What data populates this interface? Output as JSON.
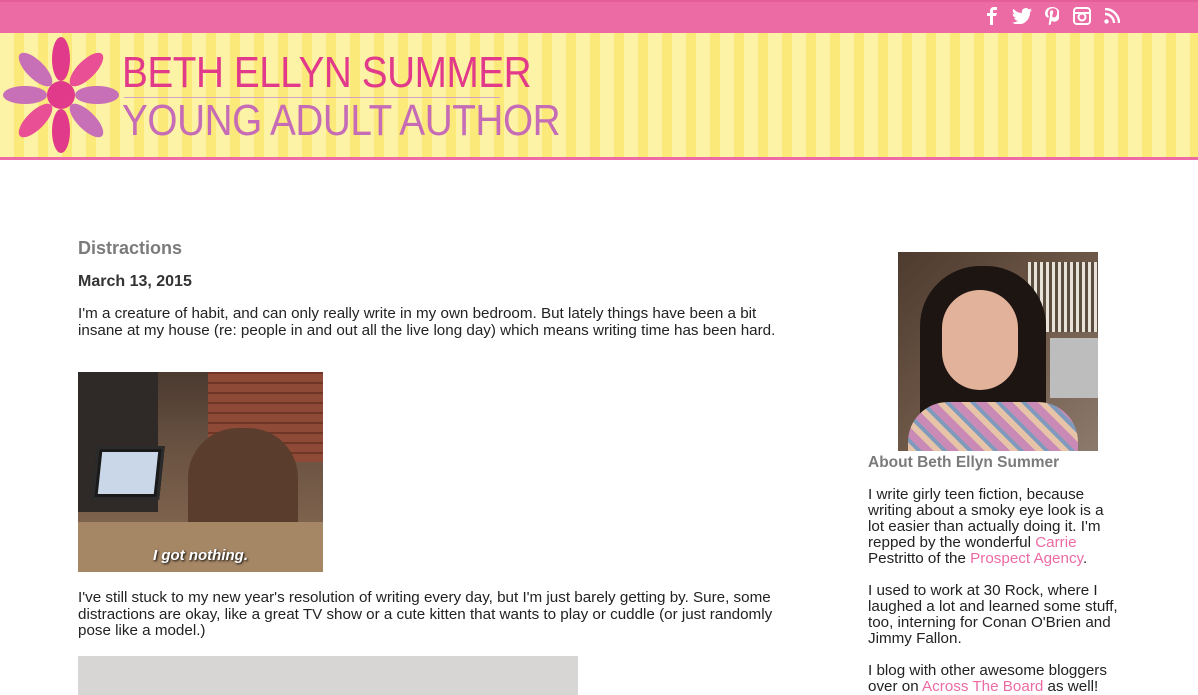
{
  "social": [
    {
      "name": "facebook-icon",
      "glyph": "f"
    },
    {
      "name": "twitter-icon",
      "glyph": "🐦"
    },
    {
      "name": "pinterest-icon",
      "glyph": "P"
    },
    {
      "name": "instagram-icon",
      "glyph": "◘"
    },
    {
      "name": "rss-icon",
      "glyph": "⋰"
    }
  ],
  "site": {
    "title_line1": "BETH ELLYN SUMMER",
    "title_line2": "YOUNG ADULT AUTHOR"
  },
  "colors": {
    "accent_pink": "#ec6ba5",
    "banner_yellow": "#fbe97a"
  },
  "post": {
    "title": "Distractions",
    "date": "March 13, 2015",
    "paragraph1": "I'm a creature of habit, and can only really write in my own bedroom. But lately things have been a bit insane at my house (re: people in and out all the live long day) which means writing time has been hard.",
    "gif_caption": "I got nothing.",
    "paragraph2": "I've still stuck to my new year's resolution of writing every day, but I'm just barely getting by. Sure, some distractions are okay, like a great TV show or a cute kitten that wants to play or cuddle (or just randomly pose like a model.)"
  },
  "sidebar": {
    "about_heading": "About Beth Ellyn Summer",
    "p1_part1": "I write girly teen fiction, because writing about a smoky eye look is a lot easier than actually doing it. I'm repped by the wonderful ",
    "p1_link1": "Carrie",
    "p1_part2": " Pestritto of the ",
    "p1_link2": "Prospect Agency",
    "p1_part3": ".",
    "p2": "I used to work at 30 Rock, where I laughed a lot and learned some stuff, too, interning for Conan O'Brien and Jimmy Fallon.",
    "p3_part1": "I blog with other awesome bloggers over on ",
    "p3_link": "Across The Board",
    "p3_part2": " as well!"
  }
}
